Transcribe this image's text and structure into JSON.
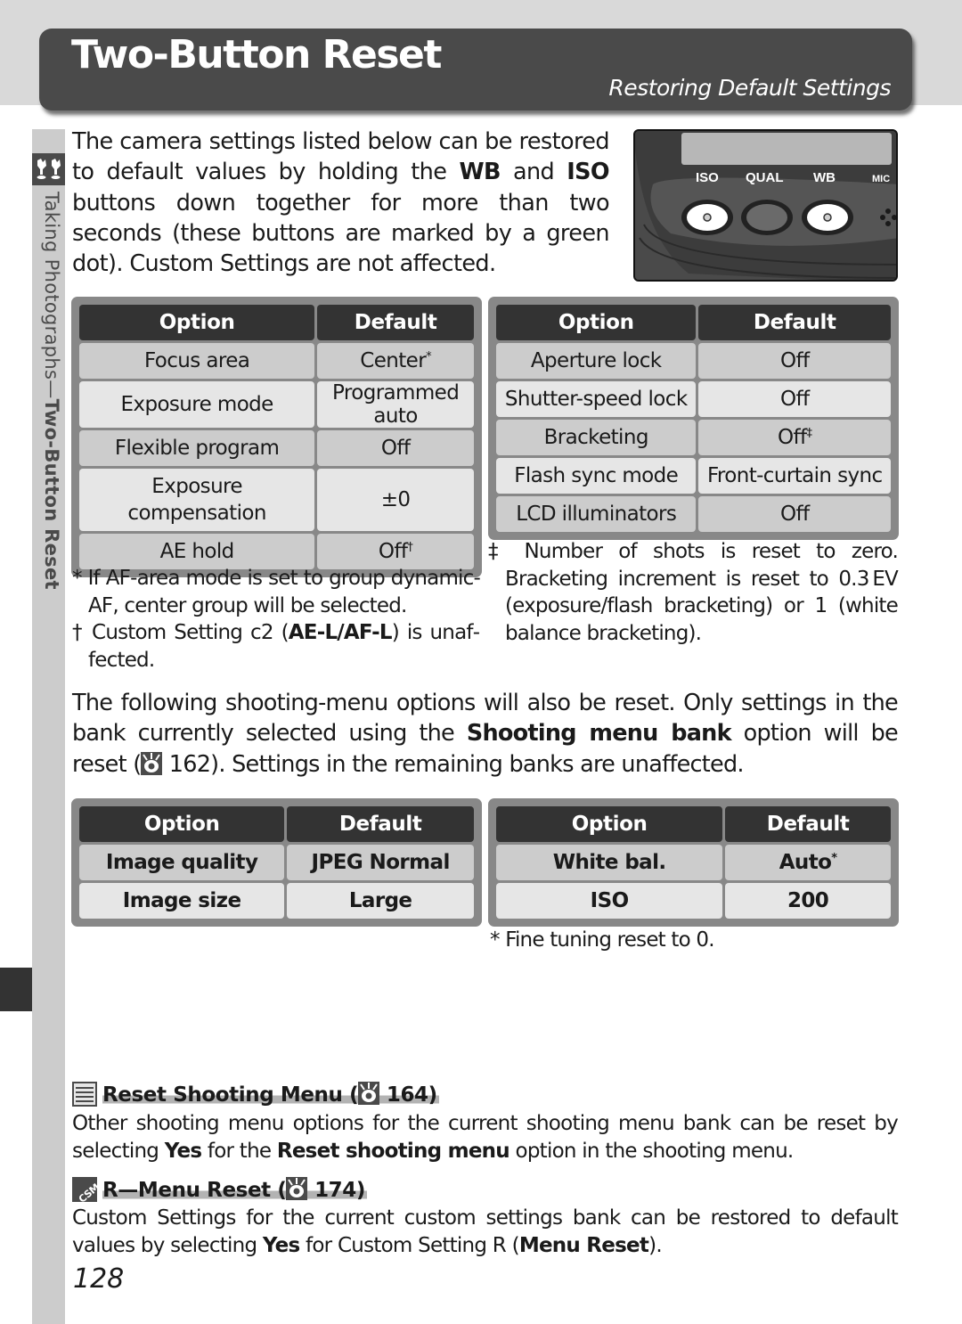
{
  "header": {
    "title": "Two-Button Reset",
    "subtitle": "Restoring Default Settings"
  },
  "side_tab": {
    "icon": "taking-photographs-icon",
    "label_normal": "Taking Photographs—",
    "label_bold": "Two-Button Reset"
  },
  "intro": {
    "part1": "The camera settings listed below can be restored to default values by holding the ",
    "bold1": "WB",
    "part2": " and ",
    "bold2": "ISO",
    "part3": " but­tons down together for more than two seconds (these buttons are marked by a green dot).  Cus­tom Settings are not affected."
  },
  "camera_illustration": {
    "labels": [
      "ISO",
      "QUAL",
      "WB",
      "MIC"
    ]
  },
  "table_camera_left": {
    "headers": [
      "Option",
      "Default"
    ],
    "rows": [
      {
        "option": "Focus area",
        "default": "Center",
        "mark": "*"
      },
      {
        "option": "Exposure mode",
        "default": "Programmed auto",
        "mark": ""
      },
      {
        "option": "Flexible program",
        "default": "Off",
        "mark": ""
      },
      {
        "option": "Exposure compensation",
        "default": "±0",
        "mark": ""
      },
      {
        "option": "AE hold",
        "default": "Off",
        "mark": "†"
      }
    ]
  },
  "table_camera_right": {
    "headers": [
      "Option",
      "Default"
    ],
    "rows": [
      {
        "option": "Aperture lock",
        "default": "Off",
        "mark": ""
      },
      {
        "option": "Shutter-speed lock",
        "default": "Off",
        "mark": ""
      },
      {
        "option": "Bracketing",
        "default": "Off",
        "mark": "‡"
      },
      {
        "option": "Flash sync mode",
        "default": "Front-curtain sync",
        "mark": ""
      },
      {
        "option": "LCD illuminators",
        "default": "Off",
        "mark": ""
      }
    ]
  },
  "footnotes_left": {
    "star": "* If AF-area mode is set to group dynamic-AF, center group will be selected.",
    "dagger_prefix": "† Custom Setting c2 (",
    "dagger_bold": "AE-L/AF-L",
    "dagger_suffix": ") is unaf­fected."
  },
  "footnotes_right": {
    "double_dagger": "‡ Number of shots is reset to zero. Bracketing increment is reset to 0.3 EV (exposure/flash bracketing) or 1 (white balance bracketing)."
  },
  "para_menu": {
    "part1": "The following shooting-menu options will also be reset.  Only settings in the bank currently selected using the ",
    "bold": "Shooting menu bank",
    "part2": " option will be reset (",
    "ref_page": "162",
    "part3": ").  Settings in the remaining banks are unaffected."
  },
  "table_menu_left": {
    "headers": [
      "Option",
      "Default"
    ],
    "rows": [
      {
        "option": "Image quality",
        "default": "JPEG Normal",
        "mark": ""
      },
      {
        "option": "Image size",
        "default": "Large",
        "mark": ""
      }
    ]
  },
  "table_menu_right": {
    "headers": [
      "Option",
      "Default"
    ],
    "rows": [
      {
        "option": "White bal.",
        "default": "Auto",
        "mark": "*"
      },
      {
        "option": "ISO",
        "default": "200",
        "mark": ""
      }
    ]
  },
  "footnote_menu": "* Fine tuning reset to 0.",
  "section_reset_menu": {
    "title": "Reset Shooting Menu (",
    "ref_page": "164)",
    "body1": "Other shooting menu options for the current shooting menu bank can be reset by selecting ",
    "bold1": "Yes",
    "body2": " for the ",
    "bold2": "Reset shooting menu",
    "body3": " option in the shooting menu."
  },
  "section_menu_reset": {
    "title": "R—Menu Reset (",
    "ref_page": "174)",
    "body1": "Custom Settings for the current custom settings bank can be restored to default values by selecting ",
    "bold1": "Yes",
    "body2": " for Custom Setting R (",
    "bold2": "Menu Reset",
    "body3": ")."
  },
  "page_number": "128"
}
